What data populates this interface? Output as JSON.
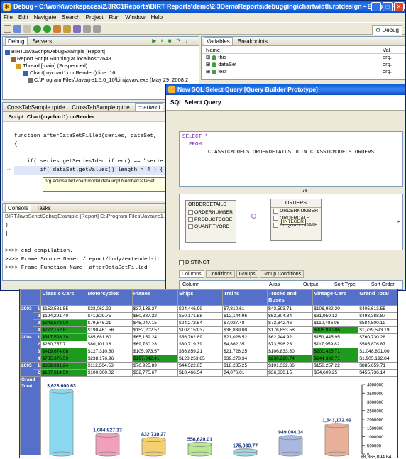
{
  "window": {
    "title": "Debug - C:\\work\\workspaces\\2.3RC1Reports\\BIRT Reports\\demo\\2.3DemoReports\\debugging\\chartwidth.rptdesign - Eclipse Platform"
  },
  "menu": [
    "File",
    "Edit",
    "Navigate",
    "Search",
    "Project",
    "Run",
    "Window",
    "Help"
  ],
  "perspective": "Debug",
  "debug_view": {
    "tabs": [
      "Debug",
      "Servers"
    ],
    "tree": [
      "BIRTJavaScriptDebugExample [Report]",
      "Report Script Running at localhost:2648",
      "Thread [main] (Suspended)",
      "Chart(mychart1).onRender() line: 16",
      "C:\\Program Files\\Java\\jre1.5.0_10\\bin\\javaw.exe (May 29, 2008 2"
    ]
  },
  "variables_view": {
    "tabs": [
      "Variables",
      "Breakpoints"
    ],
    "col_name": "Name",
    "col_value": "Val",
    "rows": [
      {
        "name": "this",
        "val": "org."
      },
      {
        "name": "dataSet",
        "val": "org."
      },
      {
        "name": "iesr",
        "val": "org."
      }
    ]
  },
  "editor": {
    "tabs": [
      "CrossTabSample.rptde",
      "CrossTabSample.rptde",
      "chartwidt"
    ],
    "script_label": "Script: Chart(mychart1).onRender",
    "lines": [
      "function afterDataSetFilled(series, dataSet,",
      "{",
      "    if( series.getSeriesIdentifier() == \"serie",
      "        if( dataSet.getValues().length > 4 ) {"
    ],
    "tooltip": "org.eclipse.birt.chart.model.data.impl.NumberDataSet",
    "tooltip_hint": "Press 'F2' for"
  },
  "console": {
    "tabs": [
      "Console",
      "Tasks"
    ],
    "header": "BIRTJavaScriptDebugExample [Report] C:\\Program Files\\Java\\jre1.5.0_10\\bin\\ja",
    "lines": [
      ")",
      "}",
      "",
      ">>>> end compilation.",
      ">>>> Frame Source Name: /report/body/extended-it",
      ">>>> Frame Function Name: afterDataSetFilled"
    ]
  },
  "dialog": {
    "title": "New SQL Select Query [Query Builder Prototype]",
    "heading": "SQL Select Query",
    "sql": [
      "SELECT *",
      "  FROM",
      "        CLASSICMODELS.ORDERDETAILS JOIN CLASSICMODELS.ORDERS"
    ],
    "table1": {
      "name": "ORDERDETAILS",
      "cols": [
        "ORDERNUMBER",
        "PRODUCTCODE",
        "QUANTITYORD"
      ]
    },
    "table2": {
      "name": "ORDERS",
      "cols": [
        "ORDERNUMBER",
        "ORDERDATE",
        "REQUIREDDATE"
      ],
      "tooltip": "INTEGER"
    },
    "distinct": "DISTINCT",
    "tabs": [
      "Columns",
      "Conditions",
      "Groups",
      "Group Conditions"
    ],
    "grid_cols": [
      "Column",
      "Alias",
      "Output",
      "Sort Type",
      "Sort Order"
    ]
  },
  "crosstab": {
    "columns": [
      "Classic Cars",
      "Motorcycles",
      "Planes",
      "Ships",
      "Trains",
      "Trucks and Buses",
      "Vintage Cars",
      "Grand Total"
    ],
    "grand_total_label": "Grand Total",
    "years": [
      {
        "year": "2003",
        "rows": [
          {
            "q": "1",
            "v": [
              "$152,581.55",
              "$33,062.22",
              "$37,136.27",
              "$24,446.99",
              "$7,810.61",
              "$43,593.71",
              "$106,982.20",
              "$405,613.55"
            ]
          },
          {
            "q": "2",
            "v": [
              "$194,291.40",
              "$41,629.75",
              "$50,387.22",
              "$50,171.58",
              "$12,144.96",
              "$62,804.84",
              "$81,959.12",
              "$493,388.87"
            ]
          },
          {
            "q": "3",
            "v": [
              "$243,578.00",
              "$79,845.21",
              "$45,047.15",
              "$24,272.54",
              "$7,027.48",
              "$73,842.46",
              "$110,486.95",
              "$584,500.19"
            ]
          },
          {
            "q": "4",
            "v": [
              "$772,152.61",
              "$190,461.56",
              "$152,202.57",
              "$102,153.37",
              "$38,839.00",
              "$176,853.58",
              "$306,930.86",
              "$1,739,593.19"
            ]
          }
        ]
      },
      {
        "year": "2004",
        "rows": [
          {
            "q": "1",
            "v": [
              "$317,508.38",
              "$85,681.60",
              "$65,159.24",
              "$56,762.89",
              "$21,028.52",
              "$62,944.92",
              "$151,445.95",
              "$760,730.28"
            ]
          },
          {
            "q": "2",
            "v": [
              "$260,757.71",
              "$80,101.18",
              "$69,780.28",
              "$30,719.39",
              "$4,862.35",
              "$73,696.23",
              "$117,959.82",
              "$585,876.87"
            ]
          },
          {
            "q": "3",
            "v": [
              "$419,674.08",
              "$127,310.80",
              "$105,973.57",
              "$66,859.21",
              "$21,728.25",
              "$106,833.60",
              "$200,426.71",
              "$1,048,801.00"
            ]
          },
          {
            "q": "4",
            "v": [
              "$785,376.59",
              "$238,176.96",
              "$197,342.41",
              "$128,253.85",
              "$39,278.34",
              "$230,220.74",
              "$244,392.71",
              "$1,905,192.84"
            ]
          }
        ]
      },
      {
        "year": "2005",
        "rows": [
          {
            "q": "1",
            "v": [
              "$369,391.24",
              "$112,364.53",
              "$76,925.89",
              "$44,522.65",
              "$18,235.25",
              "$101,332.86",
              "$158,257.22",
              "$885,659.71"
            ]
          },
          {
            "q": "2",
            "v": [
              "$107,314.59",
              "$100,300.02",
              "$32,775.67",
              "$18,466.54",
              "$4,076.01",
              "$36,638.15",
              "$54,609.25",
              "$455,736.14"
            ]
          }
        ]
      }
    ],
    "green_cells": [
      [
        2,
        0
      ],
      [
        3,
        0
      ],
      [
        3,
        6
      ],
      [
        4,
        0
      ],
      [
        6,
        0
      ],
      [
        6,
        6
      ],
      [
        7,
        0
      ],
      [
        7,
        2
      ],
      [
        7,
        5
      ],
      [
        7,
        6
      ],
      [
        8,
        0
      ],
      [
        9,
        0
      ]
    ]
  },
  "chart_data": {
    "type": "bar",
    "categories": [
      "Classic Cars",
      "Motorcycles",
      "Planes",
      "Ships",
      "Trains",
      "Trucks and Buses",
      "Vintage Cars"
    ],
    "values": [
      3623600.63,
      1084927.13,
      832730.27,
      556629.01,
      175030.77,
      949004.34,
      1643172.49
    ],
    "value_labels": [
      "3,623,600.63",
      "1,084,927.13",
      "832,730.27",
      "556,629.01",
      "175,030.77",
      "949,004.34",
      "1,643,172.49"
    ],
    "colors": [
      "#8ad8f0",
      "#f0a0b8",
      "#f5d070",
      "#b8e890",
      "#a0d8e8",
      "#a8b8e0",
      "#e8b098"
    ],
    "ylim": [
      0,
      4000000
    ],
    "ticks": [
      "4000000",
      "3500000",
      "3000000",
      "2500000",
      "2000000",
      "1500000",
      "1000000",
      "500000",
      "0"
    ],
    "grand_total": "$8,865,094.64"
  }
}
